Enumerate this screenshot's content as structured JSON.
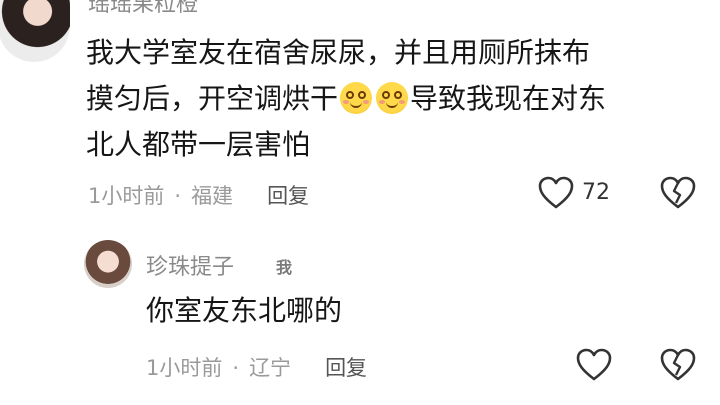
{
  "comments": [
    {
      "username": "瑶瑶果粒橙",
      "text_line1": "我大学室友在宿舍尿尿，并且用厕所抹布",
      "text_line2_before": "摸匀后，开空调烘干",
      "text_line2_after": "导致我现在对东",
      "text_line3": "北人都带一层害怕",
      "emoji": "blushing-smile-emoji",
      "time": "1小时前",
      "location": "福建",
      "reply_label": "回复",
      "like_count": "72"
    },
    {
      "username": "珍珠提子",
      "badge": "我",
      "text": "你室友东北哪的",
      "time": "1小时前",
      "location": "辽宁",
      "reply_label": "回复"
    }
  ],
  "icons": {
    "like": "heart-outline-icon",
    "dislike": "broken-heart-icon"
  },
  "colors": {
    "text": "#161616",
    "meta": "#9a9a9a",
    "background": "#ffffff"
  }
}
